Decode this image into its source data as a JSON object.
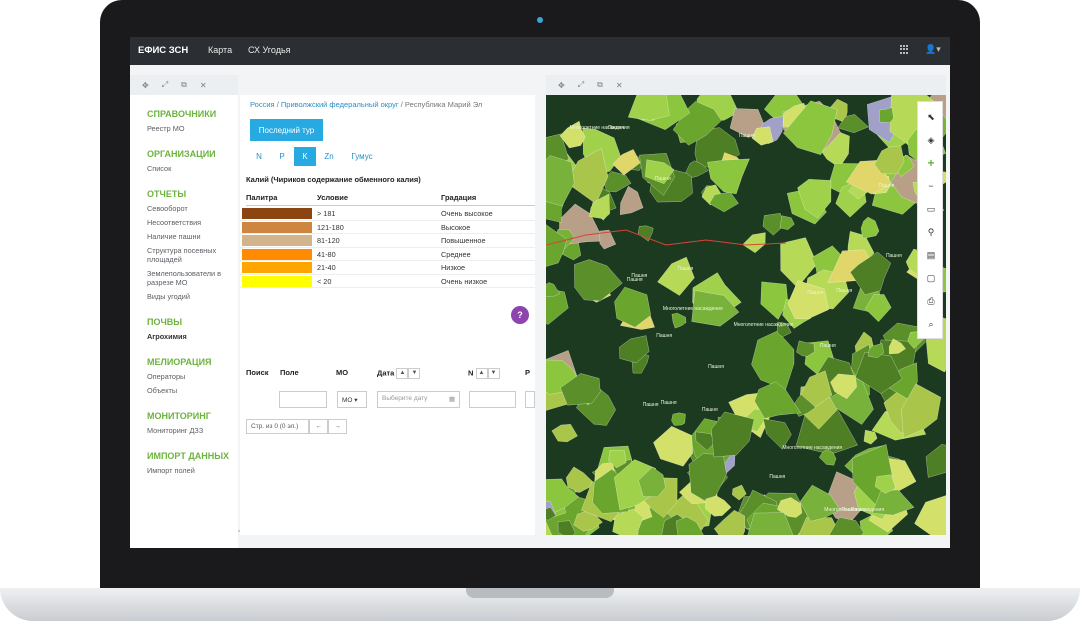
{
  "navbar": {
    "brand": "ЕФИС ЗСН",
    "links": [
      "Карта",
      "СХ Угодья"
    ]
  },
  "panel_icons": [
    "move-icon",
    "expand-icon",
    "popout-icon",
    "close-icon"
  ],
  "sidebar": {
    "sections": [
      {
        "title": "СПРАВОЧНИКИ",
        "items": [
          "Реестр МО"
        ]
      },
      {
        "title": "ОРГАНИЗАЦИИ",
        "items": [
          "Список"
        ]
      },
      {
        "title": "ОТЧЕТЫ",
        "items": [
          "Севооборот",
          "Несоответствия",
          "Наличие пашни",
          "Структура посевных площадей",
          "Землепользователи в разрезе МО",
          "Виды угодий"
        ]
      },
      {
        "title": "ПОЧВЫ",
        "items": [
          "Агрохимия"
        ]
      },
      {
        "title": "МЕЛИОРАЦИЯ",
        "items": [
          "Операторы",
          "Объекты"
        ]
      },
      {
        "title": "МОНИТОРИНГ",
        "items": [
          "Мониторинг ДЗЗ"
        ]
      },
      {
        "title": "ИМПОРТ ДАННЫХ",
        "items": [
          "Импорт полей"
        ]
      }
    ],
    "active_item": "Агрохимия"
  },
  "breadcrumb": {
    "items": [
      "Россия",
      "Приволжский федеральный округ",
      "Республика Марий Эл"
    ],
    "separator": "/"
  },
  "content": {
    "button_label": "Последний тур",
    "tabs": [
      "N",
      "P",
      "K",
      "Zn",
      "Гумус"
    ],
    "active_tab": "K",
    "legend_title": "Калий (Чириков содержание обменного калия)",
    "legend_headers": [
      "Палитра",
      "Условие",
      "Градация"
    ],
    "legend_rows": [
      {
        "color": "#8b4513",
        "condition": "> 181",
        "gradation": "Очень высокое"
      },
      {
        "color": "#cd853f",
        "condition": "121-180",
        "gradation": "Высокое"
      },
      {
        "color": "#d2b48c",
        "condition": "81-120",
        "gradation": "Повышенное"
      },
      {
        "color": "#ff8c00",
        "condition": "41-80",
        "gradation": "Среднее"
      },
      {
        "color": "#ffa500",
        "condition": "21-40",
        "gradation": "Низкое"
      },
      {
        "color": "#ffff00",
        "condition": "< 20",
        "gradation": "Очень низкое"
      }
    ],
    "help_label": "?",
    "filter_headers": [
      "Поиск",
      "Поле",
      "МО",
      "Дата",
      "N",
      "P"
    ],
    "mo_label": "МО",
    "date_placeholder": "Выберите дату",
    "pager_text": "Стр. из 0 (0 эл.)",
    "pager_prev": "←",
    "pager_next": "→"
  },
  "map": {
    "toolbar": [
      "select-icon",
      "layers-icon",
      "zoom-in-icon",
      "zoom-out-icon",
      "ruler-icon",
      "pin-icon",
      "measure-icon",
      "folder-icon",
      "print-icon",
      "search-icon"
    ],
    "labels": [
      "Пашня",
      "Пашня",
      "Пашня",
      "Пашня",
      "Пашня",
      "Пашня",
      "Пашня",
      "Пашня",
      "Пашня",
      "Пашня",
      "Пашня",
      "Пашня",
      "Многолетние насаждения",
      "Многолетние насаждения",
      "Многолетние насаждения",
      "Многолетние насаждения",
      "Многолетние насаждения",
      "Пашня",
      "Пашня",
      "Пашня",
      "Пашня",
      "Пашня",
      "Пашня",
      "Пашня"
    ]
  },
  "colors": {
    "accent": "#6db33f",
    "primary": "#27a9e1",
    "navbar": "#2b2f33",
    "help": "#8e44ad"
  }
}
